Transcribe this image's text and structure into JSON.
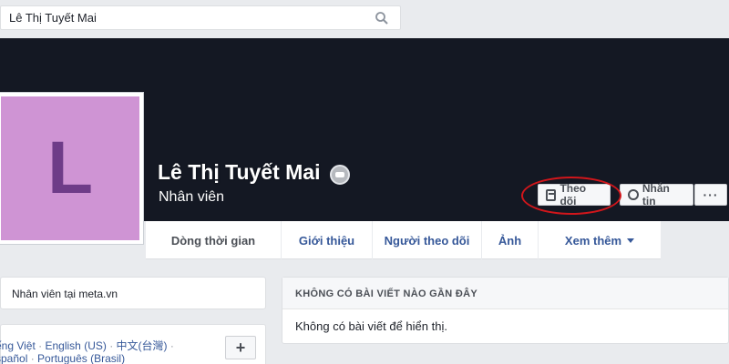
{
  "search": {
    "value": "Lê Thị Tuyết Mai",
    "icon": "search-icon"
  },
  "profile": {
    "initial": "L",
    "avatar_color": "#cf94d4",
    "initial_color": "#6e3c88",
    "name": "Lê Thị Tuyết Mai",
    "role": "Nhân viên"
  },
  "actions": {
    "follow_label": "Theo dõi",
    "message_label": "Nhắn tin",
    "more_label": "···"
  },
  "nav": {
    "tabs": [
      {
        "label": "Dòng thời gian"
      },
      {
        "label": "Giới thiệu"
      },
      {
        "label": "Người theo dõi"
      },
      {
        "label": "Ảnh"
      },
      {
        "label": "Xem thêm"
      }
    ]
  },
  "intro": {
    "job": "Nhân viên tại meta.vn"
  },
  "languages": {
    "line1_prefix": "ếng Việt",
    "english": "English (US)",
    "chinese": "中文(台灣)",
    "line2_prefix": "spañol",
    "portuguese": "Português (Brasil)",
    "add_label": "+"
  },
  "feed": {
    "header": "KHÔNG CÓ BÀI VIẾT NÀO GẦN ĐÂY",
    "empty_text": "Không có bài viết để hiển thị."
  },
  "colors": {
    "cover": "#141823",
    "link": "#365899",
    "annotation": "#d1161b"
  }
}
